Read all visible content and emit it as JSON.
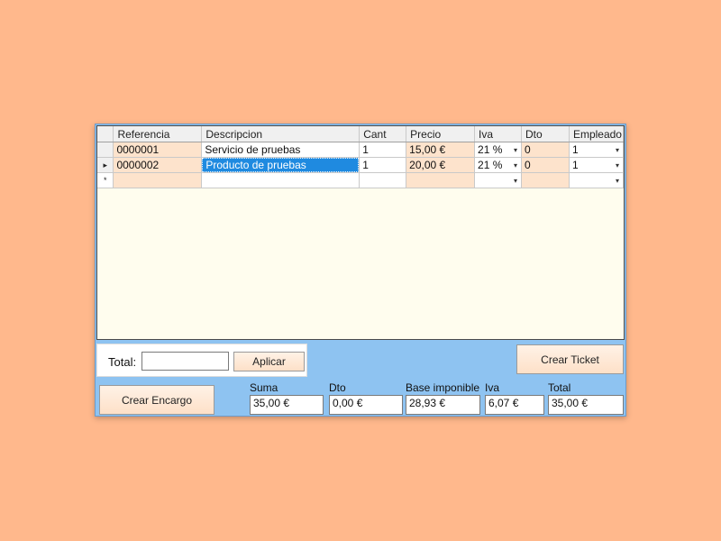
{
  "grid": {
    "columns": [
      "Referencia",
      "Descripcion",
      "Cant",
      "Precio",
      "Iva",
      "Dto",
      "Empleado"
    ],
    "rows": [
      {
        "indicator": "",
        "referencia": "0000001",
        "descripcion": "Servicio de pruebas",
        "cant": "1",
        "precio": "15,00 €",
        "iva": "21 %",
        "dto": "0",
        "empleado": "1"
      },
      {
        "indicator": "▸",
        "referencia": "0000002",
        "descripcion": "Producto de pruebas",
        "cant": "1",
        "precio": "20,00 €",
        "iva": "21 %",
        "dto": "0",
        "empleado": "1"
      }
    ],
    "new_row_indicator": "*"
  },
  "total_panel": {
    "label": "Total:",
    "value": "",
    "apply_label": "Aplicar"
  },
  "buttons": {
    "crear_ticket": "Crear Ticket",
    "crear_encargo": "Crear Encargo"
  },
  "summary": {
    "suma": {
      "label": "Suma",
      "value": "35,00 €"
    },
    "dto": {
      "label": "Dto",
      "value": "0,00 €"
    },
    "base": {
      "label": "Base imponible",
      "value": "28,93 €"
    },
    "iva": {
      "label": "Iva",
      "value": "6,07 €"
    },
    "total": {
      "label": "Total",
      "value": "35,00 €"
    }
  },
  "colors": {
    "background": "#ffb88c",
    "panel": "#8ec3f1",
    "grid": "#fffdee",
    "selection": "#1f8ae0",
    "peach_cell": "#fde3cc"
  }
}
